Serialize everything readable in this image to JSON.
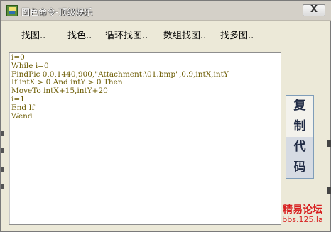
{
  "window": {
    "title": "图色命令-顶级娱乐",
    "close_label": "X"
  },
  "menu": {
    "items": [
      "找图..",
      "找色..",
      "循环找图..",
      "数组找图..",
      "找多图.."
    ]
  },
  "editor": {
    "lines": [
      "i=0",
      "While i=0",
      "FindPic 0,0,1440,900,\"Attachment:\\01.bmp\",0.9,intX,intY",
      "If intX > 0 And intY > 0 Then",
      "MoveTo intX+15,intY+20",
      "i=1",
      "End If",
      "Wend"
    ],
    "text_color": "#6b5a00"
  },
  "copy_button": {
    "chars": [
      "复",
      "制",
      "代",
      "码"
    ]
  },
  "watermark": {
    "site_name": "精易论坛",
    "url": "bbs.125.la",
    "color": "#d82020"
  }
}
